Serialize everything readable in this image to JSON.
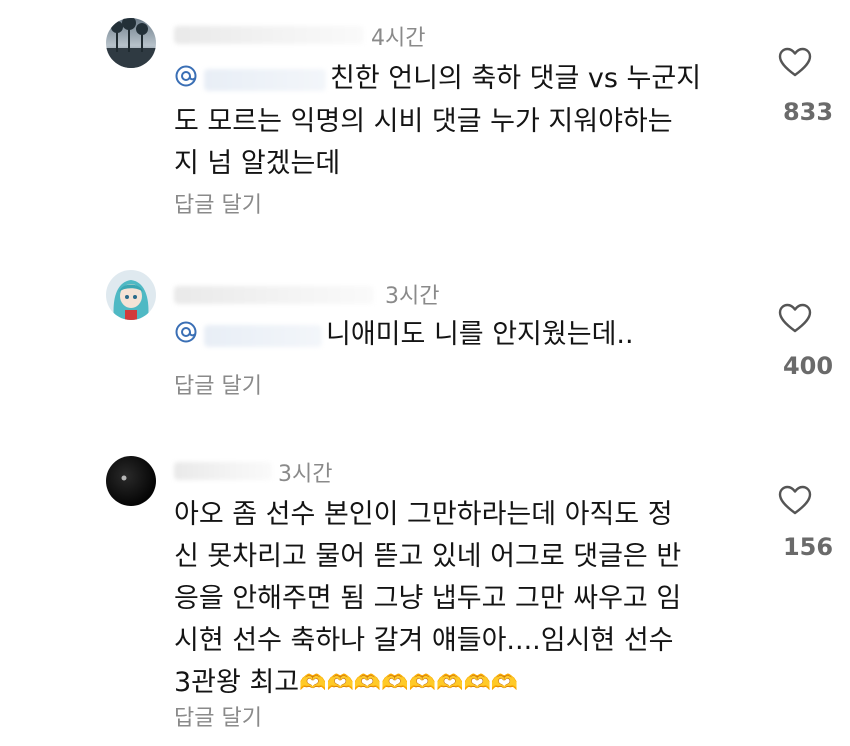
{
  "comments": [
    {
      "time": "4시간",
      "line1": "친한 언니의 축하 댓글 vs 누군지",
      "line2": "도 모르는 익명의 시비 댓글 누가 지워야하는",
      "line3": "지 넘 알겠는데",
      "reply_label": "답글 달기",
      "likes": "833"
    },
    {
      "time": "3시간",
      "line1": "니애미도 니를 안지웠는데..",
      "reply_label": "답글 달기",
      "likes": "400"
    },
    {
      "time": "3시간",
      "line1": "아오 좀 선수 본인이 그만하라는데 아직도 정",
      "line2": "신 못차리고 물어 뜯고 있네 어그로 댓글은 반",
      "line3": "응을 안해주면 됨 그냥 냅두고 그만 싸우고 임",
      "line4": "시현 선수 축하나 갈겨 얘들아....임시현 선수",
      "line5": "3관왕 최고",
      "emoji": "🫶🫶🫶🫶🫶🫶🫶🫶",
      "reply_label": "답글 달기",
      "likes": "156"
    }
  ],
  "colors": {
    "text": "#141414",
    "muted": "#8a8a8a",
    "count": "#6a6a6a",
    "mention": "#3a6fb5"
  },
  "icons": [
    "heart-outline-icon",
    "at-mention-icon"
  ]
}
